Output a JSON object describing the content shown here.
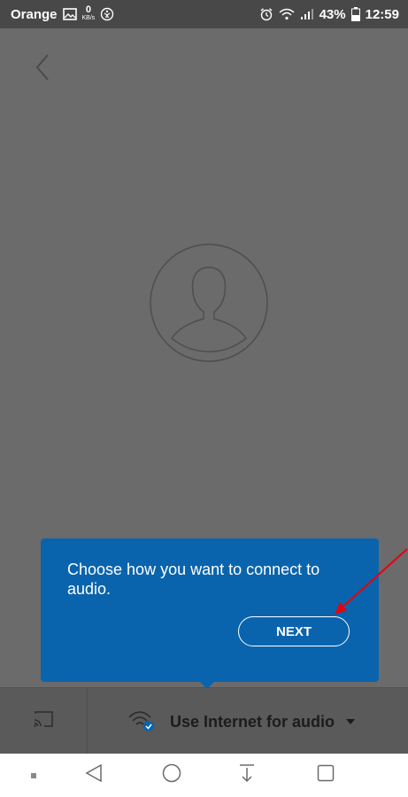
{
  "status_bar": {
    "carrier": "Orange",
    "data_rate_value": "0",
    "data_rate_unit": "KB/s",
    "battery_percent": "43%",
    "time": "12:59"
  },
  "tooltip": {
    "message": "Choose how you want to connect to audio.",
    "next_label": "NEXT"
  },
  "bottom_bar": {
    "audio_option": "Use Internet for audio"
  },
  "icons": {
    "back": "chevron-left-icon",
    "avatar": "person-silhouette-icon",
    "cast": "cast-icon",
    "audio": "wifi-audio-icon",
    "dropdown": "caret-down-icon"
  },
  "colors": {
    "tooltip_bg": "#0a64ad",
    "overlay_bg": "#6b6b6b",
    "annotation_arrow": "#e8000b",
    "status_bar_bg": "#484848"
  }
}
